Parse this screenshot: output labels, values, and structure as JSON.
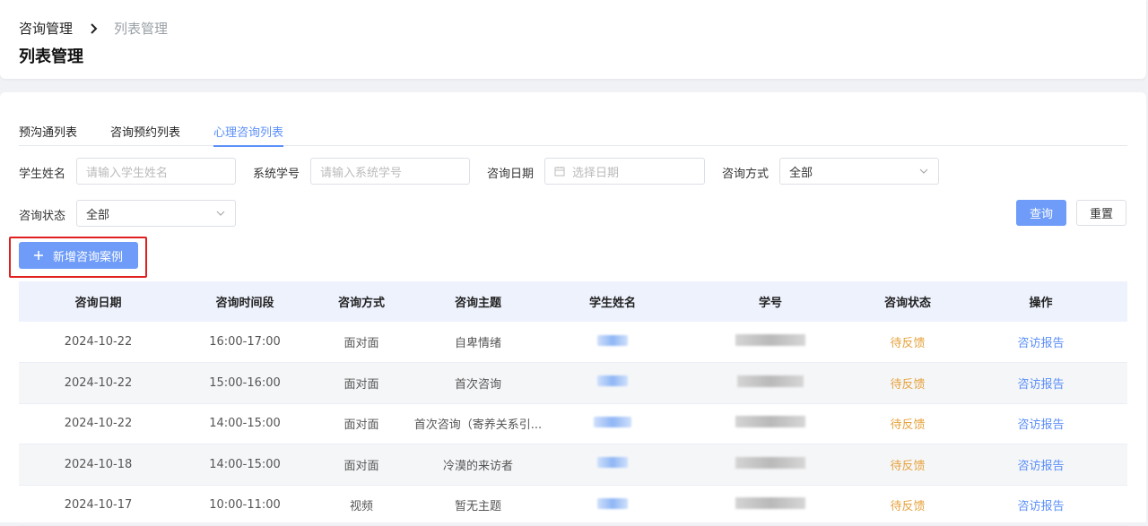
{
  "breadcrumb": {
    "parent": "咨询管理",
    "current": "列表管理"
  },
  "page_title": "列表管理",
  "tabs": [
    {
      "label": "预沟通列表",
      "active": false
    },
    {
      "label": "咨询预约列表",
      "active": false
    },
    {
      "label": "心理咨询列表",
      "active": true
    }
  ],
  "filters": {
    "student_name": {
      "label": "学生姓名",
      "placeholder": "请输入学生姓名"
    },
    "system_id": {
      "label": "系统学号",
      "placeholder": "请输入系统学号"
    },
    "date": {
      "label": "咨询日期",
      "placeholder": "选择日期"
    },
    "method": {
      "label": "咨询方式",
      "value": "全部"
    },
    "status": {
      "label": "咨询状态",
      "value": "全部"
    }
  },
  "buttons": {
    "query": "查询",
    "reset": "重置",
    "add": "新增咨询案例"
  },
  "table": {
    "headers": [
      "咨询日期",
      "咨询时间段",
      "咨询方式",
      "咨询主题",
      "学生姓名",
      "学号",
      "咨询状态",
      "操作"
    ],
    "rows": [
      {
        "date": "2024-10-22",
        "time": "16:00-17:00",
        "method": "面对面",
        "topic": "自卑情绪",
        "status": "待反馈",
        "action": "咨访报告"
      },
      {
        "date": "2024-10-22",
        "time": "15:00-16:00",
        "method": "面对面",
        "topic": "首次咨询",
        "status": "待反馈",
        "action": "咨访报告"
      },
      {
        "date": "2024-10-22",
        "time": "14:00-15:00",
        "method": "面对面",
        "topic": "首次咨询（寄养关系引...",
        "status": "待反馈",
        "action": "咨访报告"
      },
      {
        "date": "2024-10-18",
        "time": "14:00-15:00",
        "method": "面对面",
        "topic": "冷漠的来访者",
        "status": "待反馈",
        "action": "咨访报告"
      },
      {
        "date": "2024-10-17",
        "time": "10:00-11:00",
        "method": "视频",
        "topic": "暂无主题",
        "status": "待反馈",
        "action": "咨访报告"
      }
    ]
  },
  "colors": {
    "accent": "#6e9cf8",
    "status_pending": "#e6a23c",
    "highlight_border": "#e02020"
  }
}
